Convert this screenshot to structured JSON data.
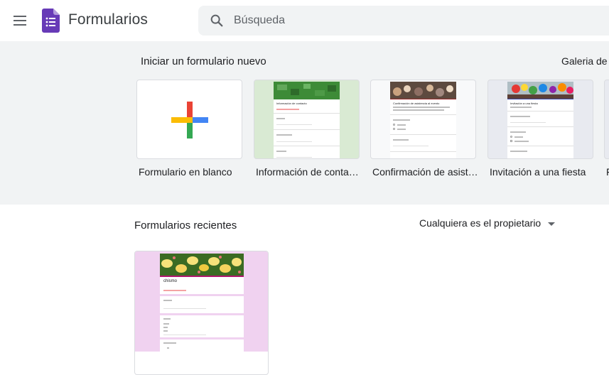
{
  "header": {
    "app_title": "Formularios",
    "search_placeholder": "Búsqueda",
    "colors": {
      "forms_purple": "#673ab7"
    },
    "icons": [
      "menu-icon",
      "forms-logo-icon",
      "search-icon"
    ]
  },
  "templates": {
    "title": "Iniciar un formulario nuevo",
    "gallery_label": "Galeria de p",
    "items": [
      {
        "label": "Formulario en blanco"
      },
      {
        "label": "Información de conta…",
        "mini_title": "Información de contacto"
      },
      {
        "label": "Confirmación de asist…",
        "mini_title": "Confirmación de asistencia al evento"
      },
      {
        "label": "Invitación a una fiesta",
        "mini_title": "Invitación a una fiesta"
      },
      {
        "label": "F"
      }
    ]
  },
  "recent": {
    "title": "Formularios recientes",
    "owner_filter": "Cualquiera es el propietario",
    "docs": [
      {
        "mini_title": "chismo"
      }
    ]
  }
}
